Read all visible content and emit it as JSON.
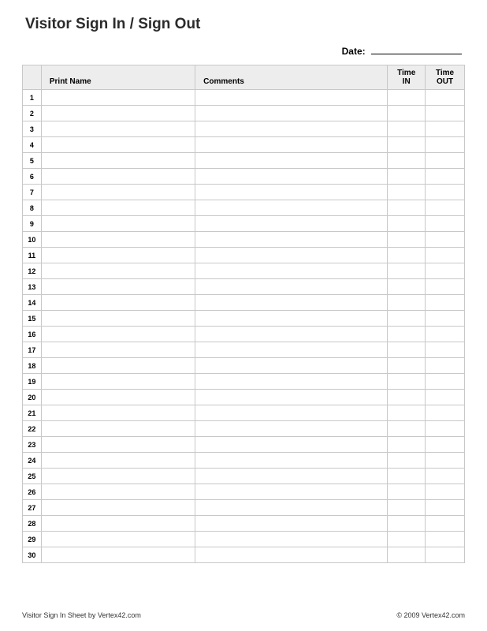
{
  "title": "Visitor Sign In / Sign Out",
  "date_label": "Date:",
  "columns": {
    "num": "",
    "name": "Print Name",
    "comments": "Comments",
    "time_in_line1": "Time",
    "time_in_line2": "IN",
    "time_out_line1": "Time",
    "time_out_line2": "OUT"
  },
  "row_count": 30,
  "footer": {
    "left": "Visitor Sign In Sheet by Vertex42.com",
    "right": "© 2009 Vertex42.com"
  }
}
